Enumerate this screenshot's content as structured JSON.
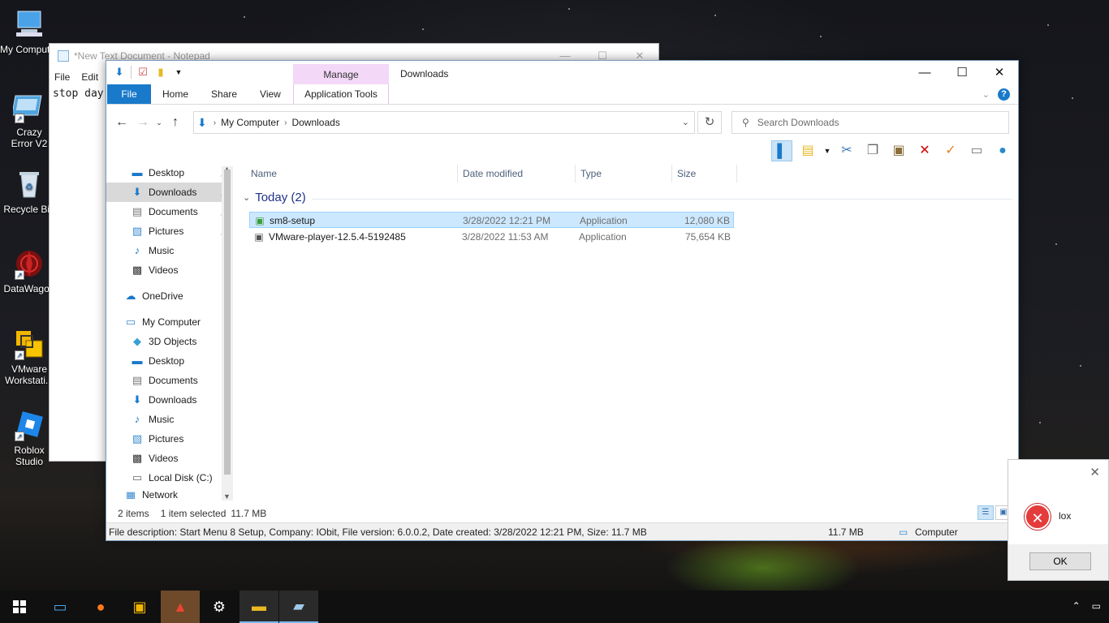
{
  "desktop": {
    "icons": [
      {
        "label": "My Computer",
        "icon": "computer-icon"
      },
      {
        "label": "Crazy Error V2",
        "icon": "crazy-error-icon"
      },
      {
        "label": "Recycle Bin",
        "icon": "recycle-bin-icon"
      },
      {
        "label": "DataWagon",
        "icon": "datawagon-icon"
      },
      {
        "label": "VMware Workstati...",
        "icon": "vmware-icon"
      },
      {
        "label": "Roblox Studio",
        "icon": "roblox-studio-icon"
      }
    ]
  },
  "notepad": {
    "title": "*New Text Document - Notepad",
    "menu": [
      "File",
      "Edit"
    ],
    "content": "stop day"
  },
  "explorer": {
    "title": "Downloads",
    "contextual_group": "Manage",
    "ribbon_tabs": [
      "File",
      "Home",
      "Share",
      "View",
      "Application Tools"
    ],
    "breadcrumb": [
      "My Computer",
      "Downloads"
    ],
    "search_placeholder": "Search Downloads",
    "nav_pane": [
      {
        "label": "Desktop",
        "icon": "desktop-folder-icon",
        "pinned": true
      },
      {
        "label": "Downloads",
        "icon": "download-arrow-icon",
        "pinned": true,
        "selected": true
      },
      {
        "label": "Documents",
        "icon": "documents-icon",
        "pinned": true
      },
      {
        "label": "Pictures",
        "icon": "pictures-icon",
        "pinned": true
      },
      {
        "label": "Music",
        "icon": "music-icon"
      },
      {
        "label": "Videos",
        "icon": "videos-icon"
      },
      {
        "label": "OneDrive",
        "icon": "onedrive-cloud-icon"
      },
      {
        "label": "My Computer",
        "icon": "computer-icon"
      },
      {
        "label": "3D Objects",
        "icon": "3d-objects-icon"
      },
      {
        "label": "Desktop",
        "icon": "desktop-folder-icon"
      },
      {
        "label": "Documents",
        "icon": "documents-icon"
      },
      {
        "label": "Downloads",
        "icon": "download-arrow-icon"
      },
      {
        "label": "Music",
        "icon": "music-icon"
      },
      {
        "label": "Pictures",
        "icon": "pictures-icon"
      },
      {
        "label": "Videos",
        "icon": "videos-icon"
      },
      {
        "label": "Local Disk (C:)",
        "icon": "local-disk-icon"
      },
      {
        "label": "Network",
        "icon": "network-icon"
      }
    ],
    "columns": [
      "Name",
      "Date modified",
      "Type",
      "Size"
    ],
    "group_label": "Today (2)",
    "files": [
      {
        "name": "sm8-setup",
        "date": "3/28/2022 12:21 PM",
        "type": "Application",
        "size": "12,080 KB",
        "selected": true
      },
      {
        "name": "VMware-player-12.5.4-5192485",
        "date": "3/28/2022 11:53 AM",
        "type": "Application",
        "size": "75,654 KB",
        "selected": false
      }
    ],
    "status": {
      "item_count": "2 items",
      "selected": "1 item selected",
      "selected_size": "11.7 MB",
      "description": "File description: Start Menu 8 Setup, Company: IObit, File version: 6.0.0.2, Date created: 3/28/2022 12:21 PM, Size: 11.7 MB",
      "size_right": "11.7 MB",
      "location": "Computer"
    }
  },
  "error_dialog": {
    "message": "lox",
    "ok_label": "OK"
  }
}
